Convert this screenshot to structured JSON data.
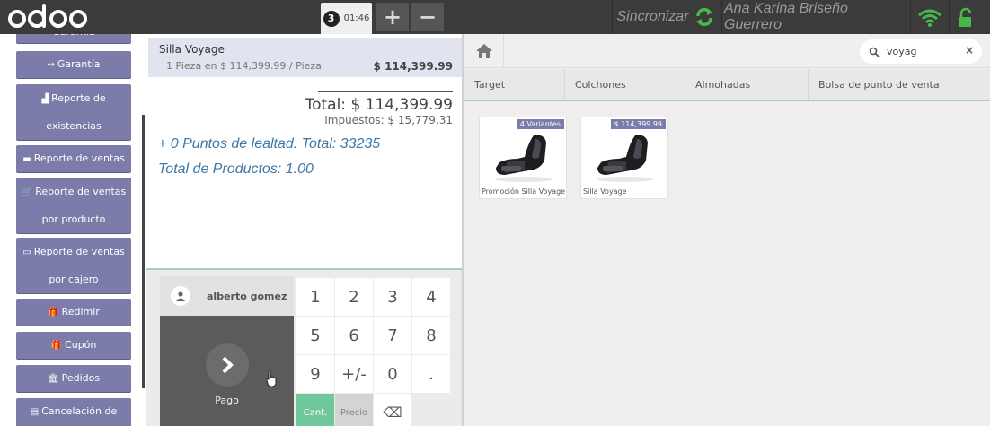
{
  "header": {
    "order_number": "3",
    "order_time": "01:46",
    "add_symbol": "+",
    "remove_symbol": "−",
    "sync_label": "Sincronizar",
    "user_name": "Ana Karina Briseño Guerrero",
    "icons": [
      "odoo-logo",
      "refresh-icon",
      "wifi-icon",
      "lock-icon"
    ]
  },
  "sidebar": {
    "items": [
      {
        "label": "Garantía",
        "icon": "↔"
      },
      {
        "label": "Garantía",
        "icon": "↔"
      },
      {
        "label_1": "Reporte de",
        "label_2": "existencias",
        "icon": "▟"
      },
      {
        "label": "Reporte de ventas",
        "icon": "▬"
      },
      {
        "label_1": "Reporte de ventas",
        "label_2": "por producto",
        "icon": "🛒"
      },
      {
        "label_1": "Reporte de ventas",
        "label_2": "por cajero",
        "icon": "▭"
      },
      {
        "label": "Redimir",
        "icon": "🎁"
      },
      {
        "label": "Cupón",
        "icon": "🎁"
      },
      {
        "label": "Pedidos",
        "icon": "🏛"
      },
      {
        "label": "Cancelación de",
        "icon": "▤"
      }
    ]
  },
  "order": {
    "line": {
      "name": "Silla Voyage",
      "qty_info": "1 Pieza en $ 114,399.99 / Pieza",
      "price": "$ 114,399.99"
    },
    "total": "Total: $ 114,399.99",
    "taxes": "Impuestos: $ 15,779.31",
    "loyalty": "+ 0 Puntos de lealtad. Total: 33235",
    "total_products": "Total de Productos: 1.00"
  },
  "pad": {
    "customer": "alberto gomez",
    "pay_label": "Pago",
    "keys": [
      "1",
      "2",
      "3",
      "4",
      "5",
      "6",
      "7",
      "8",
      "9",
      "+/-",
      "0",
      "."
    ],
    "mode_qty": "Cant.",
    "mode_price": "Precio",
    "backspace": "⌫"
  },
  "products_screen": {
    "search_value": "voyag",
    "clear": "×",
    "categories": [
      "Target",
      "Colchones",
      "Almohadas",
      "Bolsa de punto de venta"
    ],
    "products": [
      {
        "name": "Promoción Silla Voyage",
        "tag": "4 Variantes"
      },
      {
        "name": "Silla Voyage",
        "tag": "$ 114,399.99"
      }
    ]
  },
  "colors": {
    "header_bg": "#3b3b3b",
    "sidebar_button": "#7b7ca9",
    "accent_green": "#6ec89b",
    "loyalty_text": "#3e77a6"
  }
}
